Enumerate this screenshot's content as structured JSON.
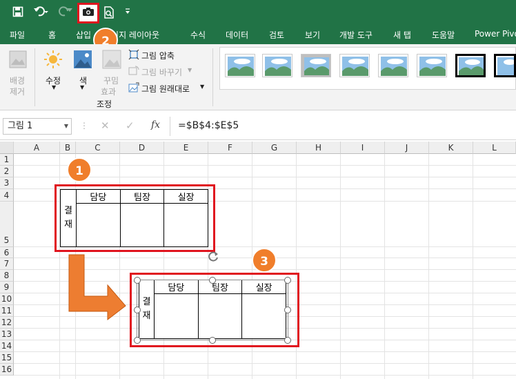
{
  "qat": {
    "save_icon": "save-icon",
    "undo_icon": "undo-icon",
    "redo_icon": "redo-icon",
    "camera_icon": "camera-icon",
    "print_preview_icon": "print-preview-icon",
    "customize_icon": "customize-qat-icon"
  },
  "tabs": [
    "파일",
    "홈",
    "삽입",
    "페이지 레이아웃",
    "수식",
    "데이터",
    "검토",
    "보기",
    "개발 도구",
    "새 탭",
    "도움말",
    "Power Pivot"
  ],
  "ribbon": {
    "bg_remove_line1": "배경",
    "bg_remove_line2": "제거",
    "correct_label": "수정",
    "color_label": "색",
    "artistic_line1": "꾸밈",
    "artistic_line2": "효과",
    "compress_label": "그림 압축",
    "change_label": "그림 바꾸기",
    "reset_label": "그림 원래대로",
    "group_label": "조정"
  },
  "formula_bar": {
    "name_box": "그림 1",
    "fx_label": "fx",
    "formula": "=$B$4:$E$5"
  },
  "columns": [
    "A",
    "B",
    "C",
    "D",
    "E",
    "F",
    "G",
    "H",
    "I",
    "J",
    "K",
    "L"
  ],
  "rows": [
    "1",
    "2",
    "3",
    "4",
    "5",
    "6",
    "7",
    "8",
    "9",
    "10",
    "11",
    "12",
    "13",
    "14",
    "15",
    "16"
  ],
  "stamp": {
    "headers": [
      "담당",
      "팀장",
      "실장"
    ],
    "side_label_1": "결",
    "side_label_2": "재"
  },
  "badges": [
    "1",
    "2",
    "3"
  ],
  "colors": {
    "excel_green": "#217346",
    "highlight_red": "#e0141e",
    "badge_orange": "#f07e2b",
    "arrow_orange": "#ed7d31"
  }
}
